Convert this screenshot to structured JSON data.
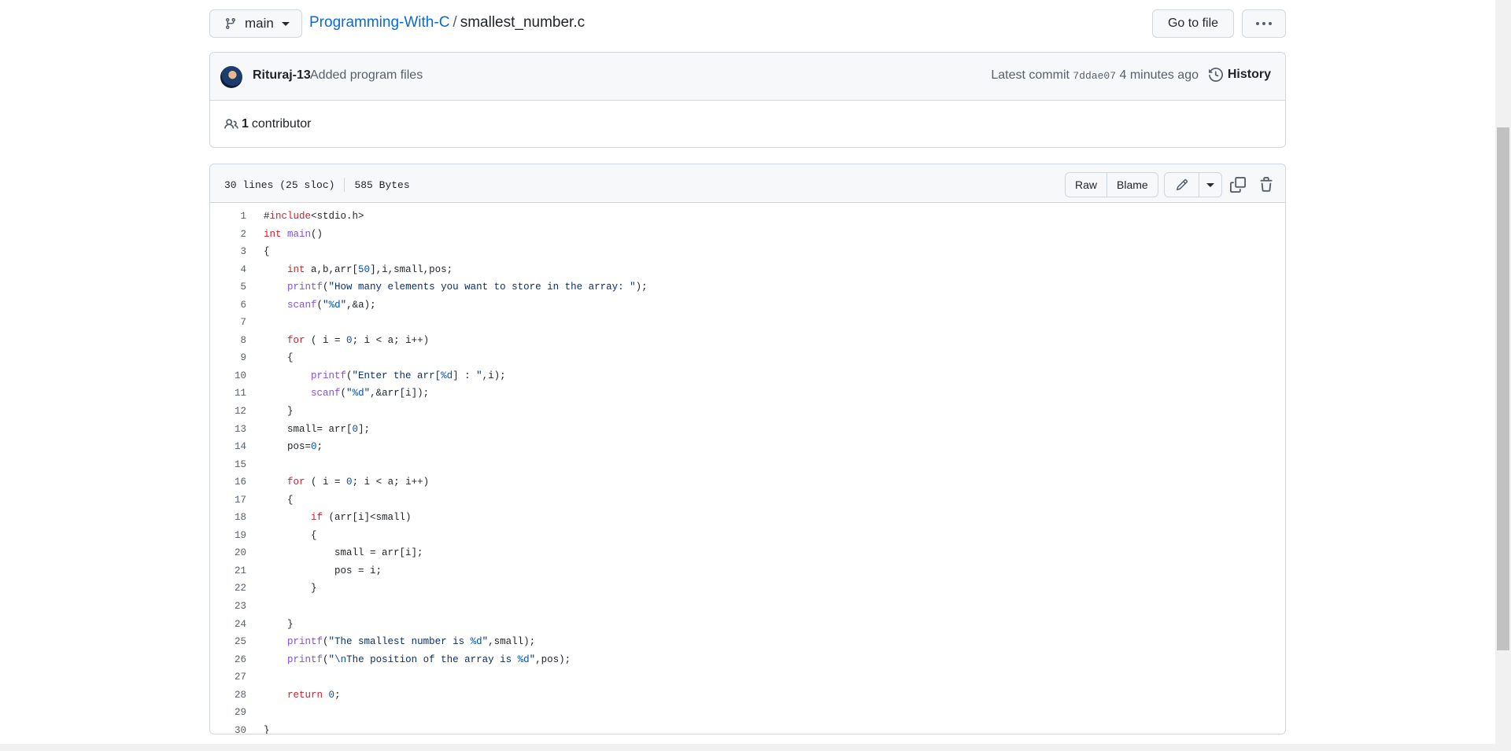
{
  "branch": {
    "name": "main"
  },
  "breadcrumb": {
    "repo": "Programming-With-C",
    "separator": "/",
    "file": "smallest_number.c"
  },
  "actions": {
    "goto_file": "Go to file"
  },
  "commit": {
    "author": "Rituraj-13",
    "message": "Added program files",
    "latest_label": "Latest commit",
    "hash": "7ddae07",
    "time": "4 minutes ago",
    "history_label": "History"
  },
  "contributors": {
    "count": "1",
    "label": "contributor"
  },
  "file": {
    "lines_info": "30 lines (25 sloc)",
    "size": "585 Bytes",
    "raw_label": "Raw",
    "blame_label": "Blame"
  },
  "code_lines": [
    "#include<stdio.h>",
    "int main()",
    "{",
    "    int a,b,arr[50],i,small,pos;",
    "    printf(\"How many elements you want to store in the array: \");",
    "    scanf(\"%d\",&a);",
    "",
    "    for ( i = 0; i < a; i++)",
    "    {",
    "        printf(\"Enter the arr[%d] : \",i);",
    "        scanf(\"%d\",&arr[i]);",
    "    }",
    "    small= arr[0];",
    "    pos=0;",
    "",
    "    for ( i = 0; i < a; i++)",
    "    {",
    "        if (arr[i]<small)",
    "        {",
    "            small = arr[i];",
    "            pos = i;",
    "        }",
    "",
    "    }",
    "    printf(\"The smallest number is %d\",small);",
    "    printf(\"\\nThe position of the array is %d\",pos);",
    "",
    "    return 0;",
    "",
    "}"
  ]
}
